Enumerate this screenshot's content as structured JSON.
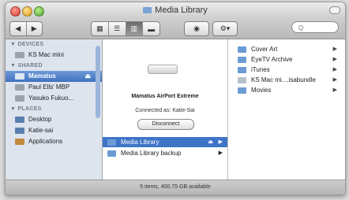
{
  "window": {
    "title": "Media Library"
  },
  "toolbar": {
    "nav": [
      "◀",
      "▶"
    ],
    "views": [
      "▦",
      "☰",
      "▥",
      "▬"
    ],
    "action": "⚙▾",
    "eye": "◉",
    "search_placeholder": "Q"
  },
  "sidebar": {
    "devices_header": "▼ DEVICES",
    "devices": [
      {
        "label": "KS Mac mini"
      }
    ],
    "shared_header": "▼ SHARED",
    "shared": [
      {
        "label": "Mamatus",
        "eject": "⏏"
      },
      {
        "label": "Paul Ells' MBP"
      },
      {
        "label": "Yasuko Fukuo..."
      }
    ],
    "places_header": "▼ PLACES",
    "places": [
      {
        "label": "Desktop"
      },
      {
        "label": "Katie-sai"
      },
      {
        "label": "Applications"
      }
    ]
  },
  "column1": {
    "server_name": "Mamatus AirPort Extreme",
    "connected_as": "Connected as: Katie-Sai",
    "disconnect_label": "Disconnect",
    "items": [
      {
        "label": "Media Library",
        "eject": "⏏",
        "arrow": "▶"
      },
      {
        "label": "Media Library backup",
        "arrow": "▶"
      }
    ]
  },
  "column2": {
    "items": [
      {
        "label": "Cover Art",
        "arrow": "▶"
      },
      {
        "label": "EyeTV Archive",
        "arrow": "▶"
      },
      {
        "label": "iTunes",
        "arrow": "▶"
      },
      {
        "label": "KS Mac mi....isabundle",
        "arrow": "▶"
      },
      {
        "label": "Movies",
        "arrow": "▶"
      }
    ]
  },
  "status": {
    "text": "5 items, 400.75 GB available"
  }
}
